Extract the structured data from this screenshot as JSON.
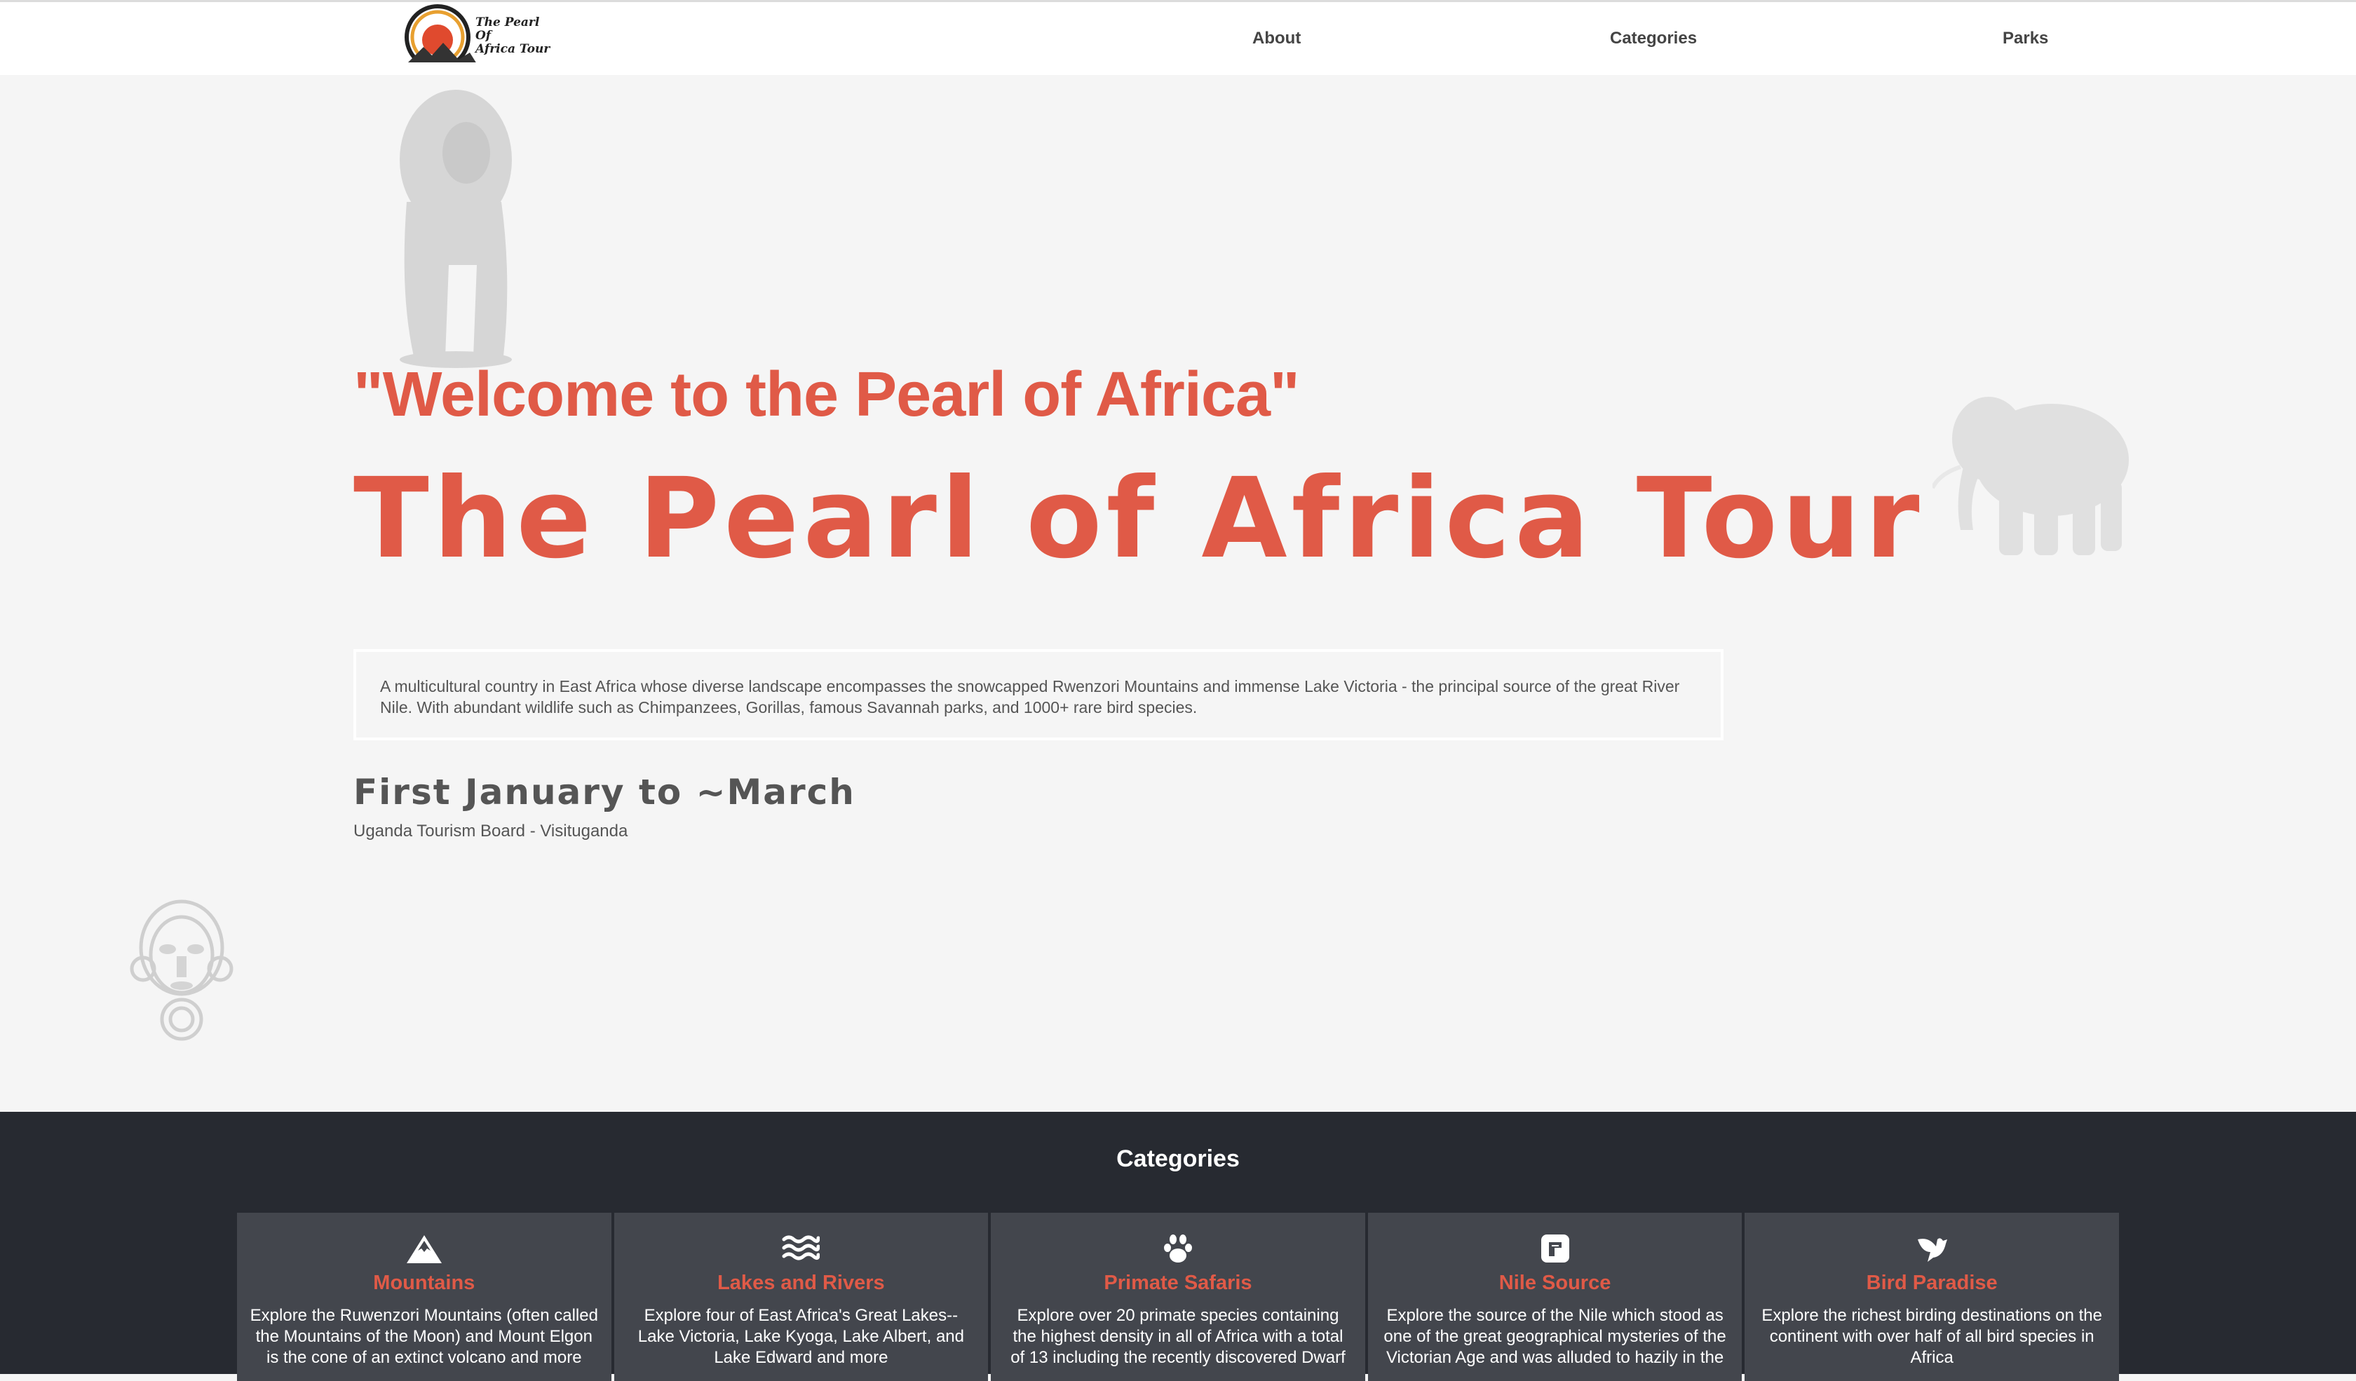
{
  "header": {
    "logo_text_line1": "The Pearl Of",
    "logo_text_line2": "Africa Tour",
    "nav": [
      {
        "label": "About"
      },
      {
        "label": "Categories"
      },
      {
        "label": "Parks"
      }
    ]
  },
  "hero": {
    "welcome": "\"Welcome to the Pearl of Africa\"",
    "title": "The Pearl of Africa Tour",
    "description": "A multicultural country in East Africa whose diverse landscape encompasses the snowcapped Rwenzori Mountains and immense Lake Victoria - the principal source of the great River Nile. With abundant wildlife such as Chimpanzees, Gorillas, famous Savannah parks, and 1000+ rare bird species.",
    "dates": "First January to ~March",
    "source": "Uganda Tourism Board - Visituganda"
  },
  "categories": {
    "heading": "Categories",
    "cards": [
      {
        "icon": "mountain-icon",
        "title": "Mountains",
        "text": "Explore the Ruwenzori Mountains (often called the Mountains of the Moon) and Mount Elgon is the cone of an extinct volcano and more"
      },
      {
        "icon": "water-icon",
        "title": "Lakes and Rivers",
        "text": "Explore four of East Africa's Great Lakes--Lake Victoria, Lake Kyoga, Lake Albert, and Lake Edward and more"
      },
      {
        "icon": "paw-icon",
        "title": "Primate Safaris",
        "text": "Explore over 20 primate species containing the highest density in all of Africa with a total of 13 including the recently discovered Dwarf"
      },
      {
        "icon": "nile-source-icon",
        "title": "Nile Source",
        "text": "Explore the source of the Nile which stood as one of the great geographical mysteries of the Victorian Age and was alluded to hazily in the"
      },
      {
        "icon": "dove-icon",
        "title": "Bird Paradise",
        "text": "Explore the richest birding destinations on the continent with over half of all bird species in Africa"
      }
    ]
  },
  "colors": {
    "accent": "#e05a47",
    "dark_section": "#272a31",
    "card_bg": "#43464d",
    "page_bg": "#f5f5f5"
  }
}
